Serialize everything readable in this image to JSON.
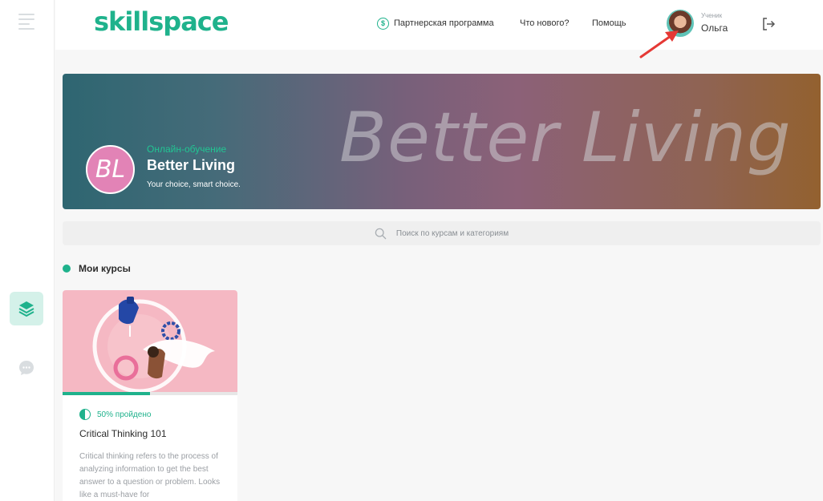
{
  "sidebar": {
    "menu_icon": "hamburger-icon",
    "items": [
      {
        "icon": "courses-stack-icon",
        "active": true
      },
      {
        "icon": "chat-icon",
        "active": false
      }
    ]
  },
  "header": {
    "logo_text": "skillspace",
    "links": [
      {
        "label": "Партнерская программа",
        "icon": "dollar-icon"
      },
      {
        "label": "Что нового?"
      },
      {
        "label": "Помощь"
      }
    ],
    "user": {
      "role": "Ученик",
      "name": "Ольга"
    },
    "logout_icon": "logout-icon"
  },
  "banner": {
    "big_text": "Better Living",
    "logo_initials": "BL",
    "school_type": "Онлайн-обучение",
    "school_name": "Better Living",
    "tagline": "Your choice, smart choice."
  },
  "search": {
    "placeholder": "Поиск по курсам и категориям"
  },
  "section": {
    "title": "Мои курсы"
  },
  "courses": [
    {
      "progress_label": "50% пройдено",
      "progress": 0.5,
      "title": "Critical Thinking 101",
      "description": "Critical thinking refers to the process of analyzing information to get the best answer to a question or problem. Looks like a must-have for"
    }
  ],
  "colors": {
    "accent": "#1fb28c",
    "card_image_bg": "#f5b8c3",
    "school_logo_bg": "#e283b6",
    "annotation_arrow": "#e53935"
  }
}
